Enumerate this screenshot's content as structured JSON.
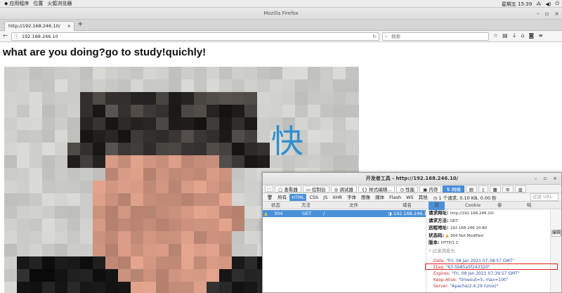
{
  "topbar": {
    "menu_apps": "应用程序",
    "menu_places": "位置",
    "menu_browser": "火狐浏览器",
    "clock": "星期五 15:39"
  },
  "window": {
    "title": "Mozilla Firefox"
  },
  "tab": {
    "title": "http://192.168.246.10/"
  },
  "nav": {
    "url": "192.168.246.10",
    "search_placeholder": "搜索"
  },
  "page": {
    "heading": "what are you doing?go to study!quichly!",
    "photo_char": "快"
  },
  "devtools": {
    "title": "开发者工具 - http://192.168.246.10/",
    "tools": [
      "查看器",
      "控制台",
      "调试器",
      "样式编辑...",
      "性能",
      "内存",
      "网络"
    ],
    "filters": [
      "所有",
      "HTML",
      "CSS",
      "JS",
      "XHR",
      "字体",
      "图像",
      "媒体",
      "Flash",
      "WS",
      "其他"
    ],
    "summary": "1 个请求, 0.10 KB, 0.00 秒",
    "url_filter_placeholder": "过滤 URL",
    "columns": {
      "status": "状态",
      "method": "方法",
      "file": "文件",
      "domain": "域名"
    },
    "subtabs": {
      "headers": "消息头",
      "cookie": "Cookie",
      "params": "参数",
      "response": "响应"
    },
    "request": {
      "status": "304",
      "method": "GET",
      "file": "/",
      "domain": "192.168.246.10"
    },
    "details": {
      "url_label": "请求网址:",
      "url_value": "http://192.168.246.10/",
      "method_label": "请求方法:",
      "method_value": "GET",
      "remote_label": "远程地址:",
      "remote_value": "192.168.246.10:80",
      "status_label": "状态码:",
      "status_value": "304 Not Modified",
      "version_label": "版本:",
      "version_value": "HTTP/1.1",
      "filter_placeholder": "过滤消息头"
    },
    "headers": [
      {
        "key": "Date:",
        "value": "\"Fri, 08 Jan 2021 07:38:57 GMT\""
      },
      {
        "key": "Etag:",
        "value": "\"63-5b85a5f243320\""
      },
      {
        "key": "Expires:",
        "value": "\"Fri, 08 Jan 2021 07:39:57 GMT\""
      },
      {
        "key": "Keep-Alive:",
        "value": "\"timeout=5, max=100\""
      },
      {
        "key": "Server:",
        "value": "\"Apache/2.4.29 (Unix)\""
      }
    ],
    "edit_label": "编辑"
  },
  "colors": {
    "accent": "#4a90d9",
    "highlight": "#e02020",
    "warn": "#f0a020"
  }
}
